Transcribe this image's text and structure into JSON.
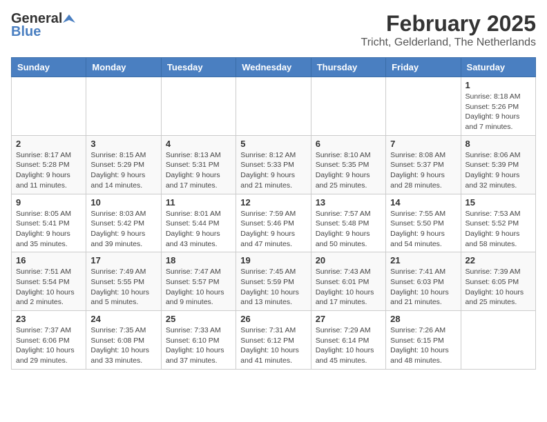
{
  "logo": {
    "general": "General",
    "blue": "Blue"
  },
  "title": "February 2025",
  "subtitle": "Tricht, Gelderland, The Netherlands",
  "weekdays": [
    "Sunday",
    "Monday",
    "Tuesday",
    "Wednesday",
    "Thursday",
    "Friday",
    "Saturday"
  ],
  "weeks": [
    [
      {
        "day": "",
        "detail": ""
      },
      {
        "day": "",
        "detail": ""
      },
      {
        "day": "",
        "detail": ""
      },
      {
        "day": "",
        "detail": ""
      },
      {
        "day": "",
        "detail": ""
      },
      {
        "day": "",
        "detail": ""
      },
      {
        "day": "1",
        "detail": "Sunrise: 8:18 AM\nSunset: 5:26 PM\nDaylight: 9 hours and 7 minutes."
      }
    ],
    [
      {
        "day": "2",
        "detail": "Sunrise: 8:17 AM\nSunset: 5:28 PM\nDaylight: 9 hours and 11 minutes."
      },
      {
        "day": "3",
        "detail": "Sunrise: 8:15 AM\nSunset: 5:29 PM\nDaylight: 9 hours and 14 minutes."
      },
      {
        "day": "4",
        "detail": "Sunrise: 8:13 AM\nSunset: 5:31 PM\nDaylight: 9 hours and 17 minutes."
      },
      {
        "day": "5",
        "detail": "Sunrise: 8:12 AM\nSunset: 5:33 PM\nDaylight: 9 hours and 21 minutes."
      },
      {
        "day": "6",
        "detail": "Sunrise: 8:10 AM\nSunset: 5:35 PM\nDaylight: 9 hours and 25 minutes."
      },
      {
        "day": "7",
        "detail": "Sunrise: 8:08 AM\nSunset: 5:37 PM\nDaylight: 9 hours and 28 minutes."
      },
      {
        "day": "8",
        "detail": "Sunrise: 8:06 AM\nSunset: 5:39 PM\nDaylight: 9 hours and 32 minutes."
      }
    ],
    [
      {
        "day": "9",
        "detail": "Sunrise: 8:05 AM\nSunset: 5:41 PM\nDaylight: 9 hours and 35 minutes."
      },
      {
        "day": "10",
        "detail": "Sunrise: 8:03 AM\nSunset: 5:42 PM\nDaylight: 9 hours and 39 minutes."
      },
      {
        "day": "11",
        "detail": "Sunrise: 8:01 AM\nSunset: 5:44 PM\nDaylight: 9 hours and 43 minutes."
      },
      {
        "day": "12",
        "detail": "Sunrise: 7:59 AM\nSunset: 5:46 PM\nDaylight: 9 hours and 47 minutes."
      },
      {
        "day": "13",
        "detail": "Sunrise: 7:57 AM\nSunset: 5:48 PM\nDaylight: 9 hours and 50 minutes."
      },
      {
        "day": "14",
        "detail": "Sunrise: 7:55 AM\nSunset: 5:50 PM\nDaylight: 9 hours and 54 minutes."
      },
      {
        "day": "15",
        "detail": "Sunrise: 7:53 AM\nSunset: 5:52 PM\nDaylight: 9 hours and 58 minutes."
      }
    ],
    [
      {
        "day": "16",
        "detail": "Sunrise: 7:51 AM\nSunset: 5:54 PM\nDaylight: 10 hours and 2 minutes."
      },
      {
        "day": "17",
        "detail": "Sunrise: 7:49 AM\nSunset: 5:55 PM\nDaylight: 10 hours and 5 minutes."
      },
      {
        "day": "18",
        "detail": "Sunrise: 7:47 AM\nSunset: 5:57 PM\nDaylight: 10 hours and 9 minutes."
      },
      {
        "day": "19",
        "detail": "Sunrise: 7:45 AM\nSunset: 5:59 PM\nDaylight: 10 hours and 13 minutes."
      },
      {
        "day": "20",
        "detail": "Sunrise: 7:43 AM\nSunset: 6:01 PM\nDaylight: 10 hours and 17 minutes."
      },
      {
        "day": "21",
        "detail": "Sunrise: 7:41 AM\nSunset: 6:03 PM\nDaylight: 10 hours and 21 minutes."
      },
      {
        "day": "22",
        "detail": "Sunrise: 7:39 AM\nSunset: 6:05 PM\nDaylight: 10 hours and 25 minutes."
      }
    ],
    [
      {
        "day": "23",
        "detail": "Sunrise: 7:37 AM\nSunset: 6:06 PM\nDaylight: 10 hours and 29 minutes."
      },
      {
        "day": "24",
        "detail": "Sunrise: 7:35 AM\nSunset: 6:08 PM\nDaylight: 10 hours and 33 minutes."
      },
      {
        "day": "25",
        "detail": "Sunrise: 7:33 AM\nSunset: 6:10 PM\nDaylight: 10 hours and 37 minutes."
      },
      {
        "day": "26",
        "detail": "Sunrise: 7:31 AM\nSunset: 6:12 PM\nDaylight: 10 hours and 41 minutes."
      },
      {
        "day": "27",
        "detail": "Sunrise: 7:29 AM\nSunset: 6:14 PM\nDaylight: 10 hours and 45 minutes."
      },
      {
        "day": "28",
        "detail": "Sunrise: 7:26 AM\nSunset: 6:15 PM\nDaylight: 10 hours and 48 minutes."
      },
      {
        "day": "",
        "detail": ""
      }
    ]
  ]
}
